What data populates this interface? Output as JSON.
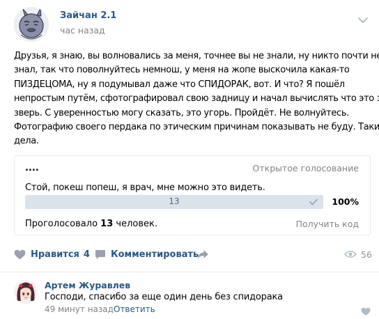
{
  "post": {
    "author": "Зайчан 2.1",
    "time": "час назад",
    "text_lines": [
      "Друзья, я знаю, вы волновались за меня, точнее вы не знали, ну никто почти не",
      "знал, так что поволнуйтесь немнош, у меня на жопе выскочила какая-то",
      "ПИЗДЕЦОМА, ну я подумывал даже что СПИДОРАК, вот. И что? Я пошёл",
      "непростым путём, сфотографировал свою задницу и начал вычислять что это за",
      "зверь. С уверенностью могу сказать, это угорь. Пройдёт. Не волнуйтесь.",
      "Фотографию своего пердака по этическим причинам показывать не буду. Такие",
      "дела."
    ],
    "icons": {
      "menu": "chevron-down-icon",
      "avatar": "bunny-avatar"
    }
  },
  "poll": {
    "title": "....",
    "type_label": "Открытое голосование",
    "question": "Стой, покеш попеш, я врач, мне можно это видеть.",
    "option_votes": "13",
    "option_percent": "100%",
    "option_fraction": 1.0,
    "voted_prefix": "Проголосовало",
    "voted_count": "13",
    "voted_suffix": "человек.",
    "get_code": "Получить код"
  },
  "actions": {
    "like_label": "Нравится",
    "like_count": "4",
    "comment_label": "Комментировать",
    "views_count": "56",
    "icons": [
      "heart-icon",
      "comment-icon",
      "share-icon",
      "eye-icon"
    ]
  },
  "comment": {
    "author": "Артем Журавлев",
    "text": "Господи, спасибо за еще один день без спидорака",
    "time": "49 минут назад",
    "reply": "Ответить"
  },
  "colors": {
    "link": "#2a5885",
    "muted": "#828282",
    "poll_bar": "#e5ebf1",
    "icon": "#99a2ad"
  }
}
